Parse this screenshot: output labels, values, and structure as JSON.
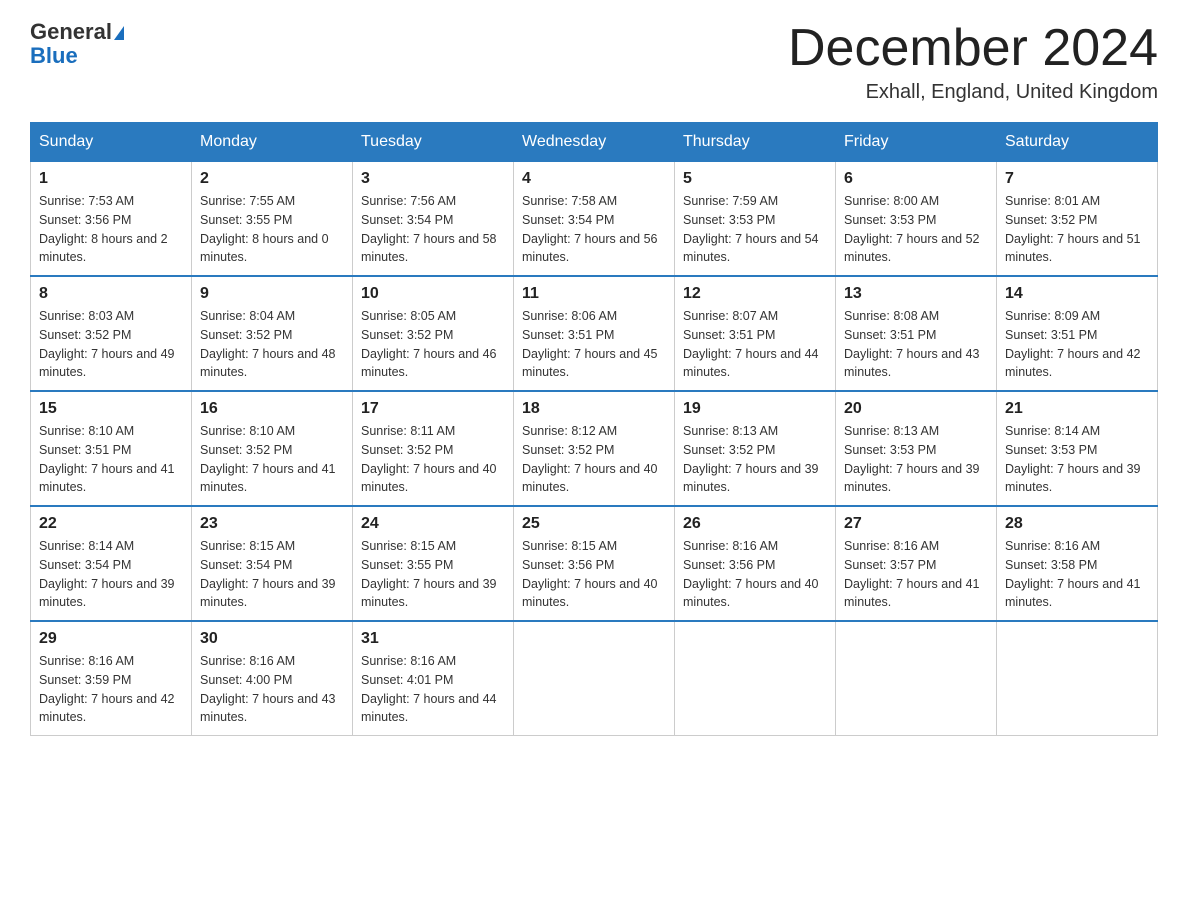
{
  "header": {
    "logo_general": "General",
    "logo_blue": "Blue",
    "month_title": "December 2024",
    "location": "Exhall, England, United Kingdom"
  },
  "weekdays": [
    "Sunday",
    "Monday",
    "Tuesday",
    "Wednesday",
    "Thursday",
    "Friday",
    "Saturday"
  ],
  "weeks": [
    [
      {
        "day": "1",
        "sunrise": "7:53 AM",
        "sunset": "3:56 PM",
        "daylight": "8 hours and 2 minutes."
      },
      {
        "day": "2",
        "sunrise": "7:55 AM",
        "sunset": "3:55 PM",
        "daylight": "8 hours and 0 minutes."
      },
      {
        "day": "3",
        "sunrise": "7:56 AM",
        "sunset": "3:54 PM",
        "daylight": "7 hours and 58 minutes."
      },
      {
        "day": "4",
        "sunrise": "7:58 AM",
        "sunset": "3:54 PM",
        "daylight": "7 hours and 56 minutes."
      },
      {
        "day": "5",
        "sunrise": "7:59 AM",
        "sunset": "3:53 PM",
        "daylight": "7 hours and 54 minutes."
      },
      {
        "day": "6",
        "sunrise": "8:00 AM",
        "sunset": "3:53 PM",
        "daylight": "7 hours and 52 minutes."
      },
      {
        "day": "7",
        "sunrise": "8:01 AM",
        "sunset": "3:52 PM",
        "daylight": "7 hours and 51 minutes."
      }
    ],
    [
      {
        "day": "8",
        "sunrise": "8:03 AM",
        "sunset": "3:52 PM",
        "daylight": "7 hours and 49 minutes."
      },
      {
        "day": "9",
        "sunrise": "8:04 AM",
        "sunset": "3:52 PM",
        "daylight": "7 hours and 48 minutes."
      },
      {
        "day": "10",
        "sunrise": "8:05 AM",
        "sunset": "3:52 PM",
        "daylight": "7 hours and 46 minutes."
      },
      {
        "day": "11",
        "sunrise": "8:06 AM",
        "sunset": "3:51 PM",
        "daylight": "7 hours and 45 minutes."
      },
      {
        "day": "12",
        "sunrise": "8:07 AM",
        "sunset": "3:51 PM",
        "daylight": "7 hours and 44 minutes."
      },
      {
        "day": "13",
        "sunrise": "8:08 AM",
        "sunset": "3:51 PM",
        "daylight": "7 hours and 43 minutes."
      },
      {
        "day": "14",
        "sunrise": "8:09 AM",
        "sunset": "3:51 PM",
        "daylight": "7 hours and 42 minutes."
      }
    ],
    [
      {
        "day": "15",
        "sunrise": "8:10 AM",
        "sunset": "3:51 PM",
        "daylight": "7 hours and 41 minutes."
      },
      {
        "day": "16",
        "sunrise": "8:10 AM",
        "sunset": "3:52 PM",
        "daylight": "7 hours and 41 minutes."
      },
      {
        "day": "17",
        "sunrise": "8:11 AM",
        "sunset": "3:52 PM",
        "daylight": "7 hours and 40 minutes."
      },
      {
        "day": "18",
        "sunrise": "8:12 AM",
        "sunset": "3:52 PM",
        "daylight": "7 hours and 40 minutes."
      },
      {
        "day": "19",
        "sunrise": "8:13 AM",
        "sunset": "3:52 PM",
        "daylight": "7 hours and 39 minutes."
      },
      {
        "day": "20",
        "sunrise": "8:13 AM",
        "sunset": "3:53 PM",
        "daylight": "7 hours and 39 minutes."
      },
      {
        "day": "21",
        "sunrise": "8:14 AM",
        "sunset": "3:53 PM",
        "daylight": "7 hours and 39 minutes."
      }
    ],
    [
      {
        "day": "22",
        "sunrise": "8:14 AM",
        "sunset": "3:54 PM",
        "daylight": "7 hours and 39 minutes."
      },
      {
        "day": "23",
        "sunrise": "8:15 AM",
        "sunset": "3:54 PM",
        "daylight": "7 hours and 39 minutes."
      },
      {
        "day": "24",
        "sunrise": "8:15 AM",
        "sunset": "3:55 PM",
        "daylight": "7 hours and 39 minutes."
      },
      {
        "day": "25",
        "sunrise": "8:15 AM",
        "sunset": "3:56 PM",
        "daylight": "7 hours and 40 minutes."
      },
      {
        "day": "26",
        "sunrise": "8:16 AM",
        "sunset": "3:56 PM",
        "daylight": "7 hours and 40 minutes."
      },
      {
        "day": "27",
        "sunrise": "8:16 AM",
        "sunset": "3:57 PM",
        "daylight": "7 hours and 41 minutes."
      },
      {
        "day": "28",
        "sunrise": "8:16 AM",
        "sunset": "3:58 PM",
        "daylight": "7 hours and 41 minutes."
      }
    ],
    [
      {
        "day": "29",
        "sunrise": "8:16 AM",
        "sunset": "3:59 PM",
        "daylight": "7 hours and 42 minutes."
      },
      {
        "day": "30",
        "sunrise": "8:16 AM",
        "sunset": "4:00 PM",
        "daylight": "7 hours and 43 minutes."
      },
      {
        "day": "31",
        "sunrise": "8:16 AM",
        "sunset": "4:01 PM",
        "daylight": "7 hours and 44 minutes."
      },
      null,
      null,
      null,
      null
    ]
  ]
}
